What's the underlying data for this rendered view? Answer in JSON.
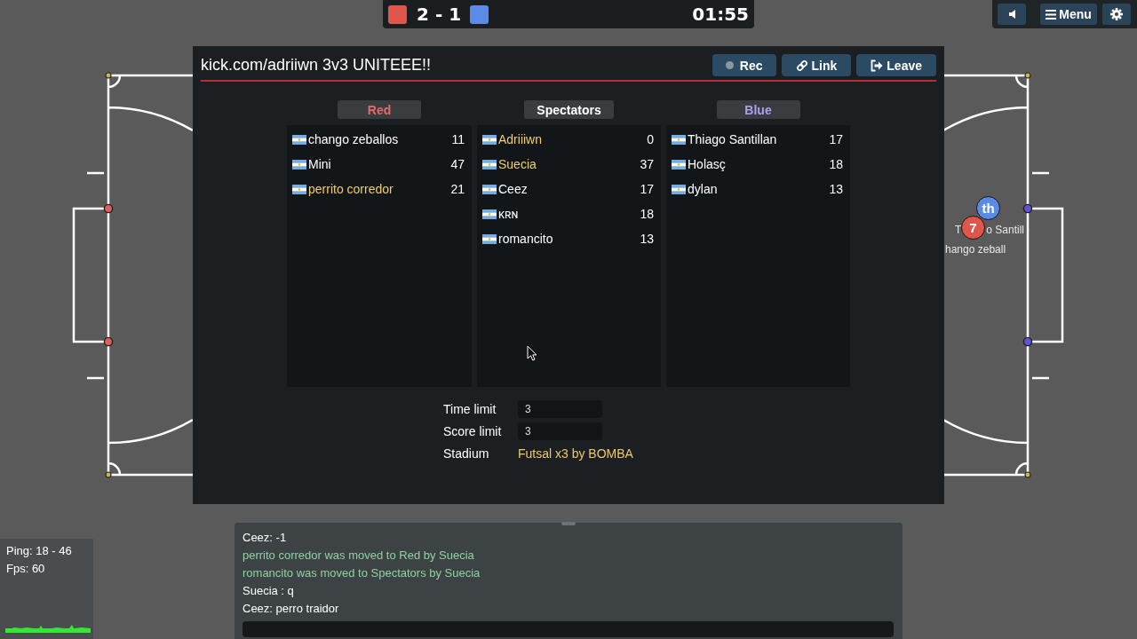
{
  "scoreboard": {
    "score": "2 - 1",
    "time": "01:55"
  },
  "top_menu": {
    "menu_label": "Menu"
  },
  "field": {
    "players": [
      {
        "kind": "blue",
        "avatar": "th",
        "label_parts": [
          "T",
          "o Santill"
        ]
      },
      {
        "kind": "red",
        "avatar": "7",
        "label_parts": [
          "hango zeball"
        ]
      }
    ]
  },
  "room": {
    "title": "kick.com/adriiwn 3v3 UNITEEE!!",
    "buttons": [
      {
        "kind": "rec",
        "label": "Rec",
        "recording": false
      },
      {
        "kind": "link",
        "label": "Link"
      },
      {
        "kind": "leave",
        "label": "Leave"
      }
    ],
    "teams": [
      {
        "kind": "red",
        "name": "Red",
        "players": [
          {
            "name": "chango zeballos",
            "ping": "11",
            "admin": false
          },
          {
            "name": "Mini",
            "ping": "47",
            "admin": false
          },
          {
            "name": "perrito corredor",
            "ping": "21",
            "admin": true
          }
        ]
      },
      {
        "kind": "spectators",
        "name": "Spectators",
        "players": [
          {
            "name": "Adriiiwn",
            "ping": "0",
            "admin": true
          },
          {
            "name": "Suecia",
            "ping": "37",
            "admin": true
          },
          {
            "name": "Ceez",
            "ping": "17",
            "admin": false
          },
          {
            "name": "ᴋʀɴ",
            "ping": "18",
            "admin": false
          },
          {
            "name": "romancito",
            "ping": "13",
            "admin": false
          }
        ]
      },
      {
        "kind": "blue",
        "name": "Blue",
        "players": [
          {
            "name": "Thiago Santillan",
            "ping": "17",
            "admin": false
          },
          {
            "name": "Holasç",
            "ping": "18",
            "admin": false
          },
          {
            "name": "dylan",
            "ping": "13",
            "admin": false
          }
        ]
      }
    ],
    "settings": [
      {
        "kind": "input",
        "label": "Time limit",
        "value": "3"
      },
      {
        "kind": "input",
        "label": "Score limit",
        "value": "3"
      },
      {
        "kind": "link",
        "label": "Stadium",
        "value": "Futsal x3 by BOMBA"
      }
    ]
  },
  "chat": {
    "messages": [
      {
        "kind": "chat",
        "text": "Ceez: -1"
      },
      {
        "kind": "notice",
        "text": "perrito corredor was moved to Red by Suecia"
      },
      {
        "kind": "notice",
        "text": "romancito was moved to Spectators by Suecia"
      },
      {
        "kind": "chat",
        "text": "Suecia : q"
      },
      {
        "kind": "chat",
        "text": "Ceez: perro traidor"
      }
    ]
  },
  "stats": {
    "ping": "Ping: 18 - 46",
    "fps": "Fps: 60"
  }
}
